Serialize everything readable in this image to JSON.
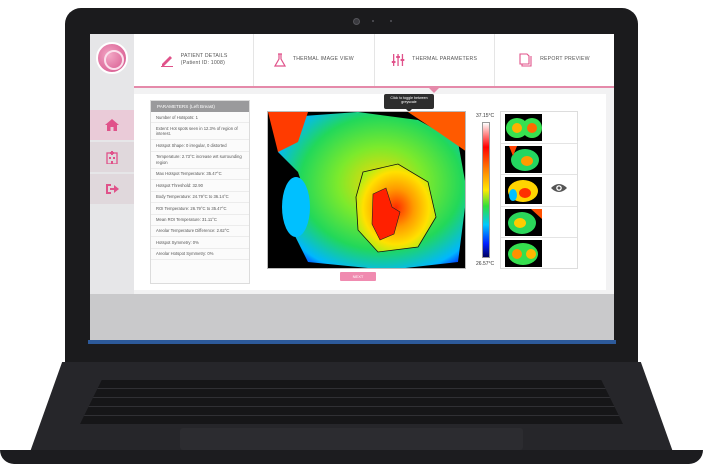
{
  "tabs": [
    {
      "label": "PATIENT DETAILS\n(Patient ID: 1008)",
      "icon": "pencil-icon"
    },
    {
      "label": "THERMAL IMAGE VIEW",
      "icon": "flask-icon"
    },
    {
      "label": "THERMAL PARAMETERS",
      "icon": "sliders-icon",
      "active": true
    },
    {
      "label": "REPORT PREVIEW",
      "icon": "document-icon"
    }
  ],
  "sidebar": {
    "items": [
      {
        "icon": "home-icon"
      },
      {
        "icon": "hospital-icon"
      },
      {
        "icon": "logout-icon"
      }
    ]
  },
  "params": {
    "title": "PARAMETERS (Left Breast)",
    "items": [
      "Number of Hotspots: 1",
      "Extent: Hot spots seen in 12.3% of region of interest.",
      "Hotspot Shape: 0 irregular, 0 distorted",
      "Temperature: 2.73°C increase wrt surrounding region",
      "Max Hotspot Temperature: 35.47°C",
      "Hotspot Threshold: 32.90",
      "Body Temperature: 24.79°C to 36.14°C",
      "ROI Temperature: 26.79°C to 35.47°C",
      "Mean ROI Temperature: 31.11°C",
      "Areolar Temperature Difference: 2.62°C",
      "Hotspot Symmetry: 0%",
      "Areolar Hotspot Symmetry: 0%"
    ]
  },
  "tooltip": "Click to toggle between greyscale",
  "scale": {
    "max": "37.15°C",
    "min": "26.57°C"
  },
  "next_label": "NEXT",
  "colors": {
    "accent": "#e58aaa",
    "button": "#f08bb0"
  }
}
